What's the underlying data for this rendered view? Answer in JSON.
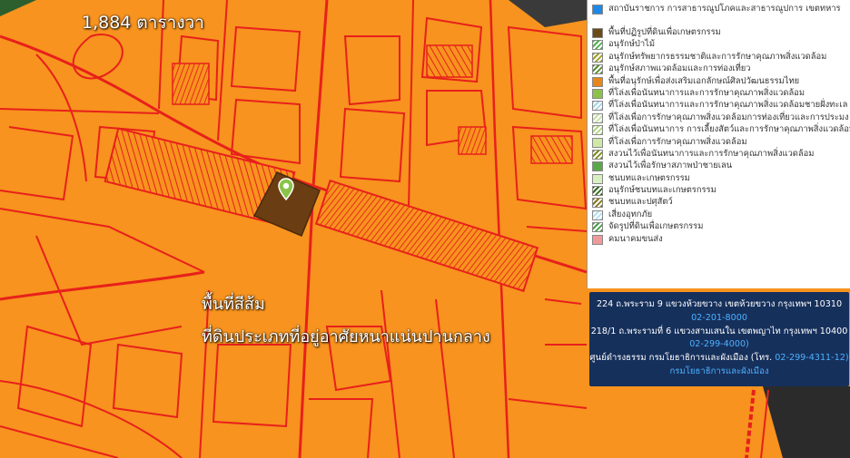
{
  "map": {
    "area_label": "1,884 ตารางวา",
    "zone_title": "พื้นที่สีส้ม",
    "zone_description": "ที่ดินประเภทที่อยู่อาศัยหนาแน่นปานกลาง",
    "colors": {
      "zone_fill": "#f7931e",
      "parcel_line": "#e8201b",
      "selected_parcel": "#6b3d13",
      "background_dark": "#2a2a2a"
    },
    "pin_icon": "map-pin-icon"
  },
  "legend": {
    "items": [
      {
        "label": "สถาบันราชการ การสาธารณูปโภคและสาธารณูปการ เขตทหาร",
        "swatch": "#1e88e5",
        "pattern": "solid"
      },
      {
        "label": "พื้นที่ปฏิรูปที่ดินเพื่อเกษตรกรรม",
        "swatch": "#6b4a1a",
        "pattern": "solid"
      },
      {
        "label": "อนุรักษ์ป่าไม้",
        "swatch": "#4caf50",
        "pattern": "hatch"
      },
      {
        "label": "อนุรักษ์ทรัพยากรธรรมชาติและการรักษาคุณภาพสิ่งแวดล้อม",
        "swatch": "#9e9d24",
        "pattern": "hatch"
      },
      {
        "label": "อนุรักษ์สภาพแวดล้อมและการท่องเที่ยว",
        "swatch": "#558b2f",
        "pattern": "hatch"
      },
      {
        "label": "พื้นที่อนุรักษ์เพื่อส่งเสริมเอกลักษณ์ศิลปวัฒนธรรมไทย",
        "swatch": "#e8861a",
        "pattern": "solid"
      },
      {
        "label": "ที่โล่งเพื่อนันทนาการและการรักษาคุณภาพสิ่งแวดล้อม",
        "swatch": "#8bc34a",
        "pattern": "solid"
      },
      {
        "label": "ที่โล่งเพื่อนันทนาการและการรักษาคุณภาพสิ่งแวดล้อมชายฝั่งทะเล",
        "swatch": "#a5d6e6",
        "pattern": "hatch"
      },
      {
        "label": "ที่โล่งเพื่อการรักษาคุณภาพสิ่งแวดล้อมการท่องเที่ยวและการประมง",
        "swatch": "#c5e1a5",
        "pattern": "hatch"
      },
      {
        "label": "ที่โล่งเพื่อนันทนาการ การเลี้ยงสัตว์และการรักษาคุณภาพสิ่งแวดล้อม",
        "swatch": "#aed581",
        "pattern": "hatch"
      },
      {
        "label": "ที่โล่งเพื่อการรักษาคุณภาพสิ่งแวดล้อม",
        "swatch": "#cfe8a8",
        "pattern": "solid"
      },
      {
        "label": "สงวนไว้เพื่อนันทนาการและการรักษาคุณภาพสิ่งแวดล้อม",
        "swatch": "#7a8a1a",
        "pattern": "hatch"
      },
      {
        "label": "สงวนไว้เพื่อรักษาสภาพป่าชายเลน",
        "swatch": "#5aa84a",
        "pattern": "solid"
      },
      {
        "label": "ชนบทและเกษตรกรรม",
        "swatch": "#d7f0c2",
        "pattern": "solid"
      },
      {
        "label": "อนุรักษ์ชนบทและเกษตรกรรม",
        "swatch": "#33691e",
        "pattern": "hatch"
      },
      {
        "label": "ชนบทและปศุสัตว์",
        "swatch": "#827717",
        "pattern": "hatch"
      },
      {
        "label": "เสี่ยงอุทกภัย",
        "swatch": "#b3e0f2",
        "pattern": "hatch"
      },
      {
        "label": "จัดรูปที่ดินเพื่อเกษตรกรรม",
        "swatch": "#43a047",
        "pattern": "hatch"
      },
      {
        "label": "คมนาคมขนส่ง",
        "swatch": "#ef9a9a",
        "pattern": "solid"
      }
    ]
  },
  "contact": {
    "address1": "224 ถ.พระราม 9 แขวงห้วยขวาง เขตห้วยขวาง กรุงเทพฯ 10310",
    "phone1": "02-201-8000",
    "address2": "218/1 ถ.พระรามที่ 6 แขวงสามเสนใน เขตพญาไท กรุงเทพฯ 10400",
    "phone2": "02-299-4000)",
    "info_prefix": "ศูนย์ดำรงธรรม กรมโยธาธิการและผังเมือง (โทร.",
    "info_phone": "02-299-4311-12)",
    "department_link": "กรมโยธาธิการและผังเมือง"
  }
}
